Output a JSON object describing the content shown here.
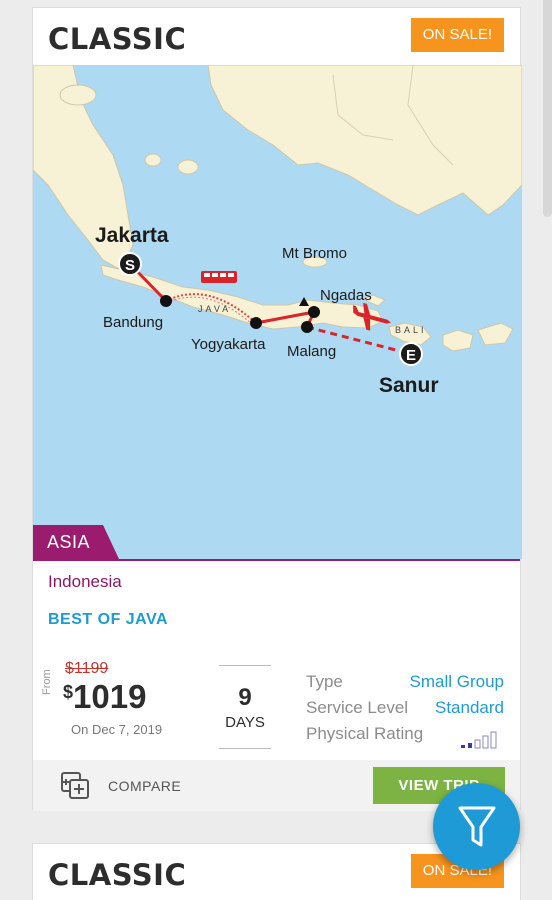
{
  "cards": [
    {
      "style": "CLASSIC",
      "badge": "ON SALE!",
      "region": "ASIA",
      "country": "Indonesia",
      "trip_name": "BEST OF JAVA",
      "price_prefix": "From",
      "old_price": "$1199",
      "currency_symbol": "$",
      "price": "1019",
      "departure": "On Dec 7, 2019",
      "days": "9",
      "days_label": "DAYS",
      "attributes": [
        {
          "label": "Type",
          "value": "Small Group"
        },
        {
          "label": "Service Level",
          "value": "Standard"
        },
        {
          "label": "Physical Rating",
          "value": ""
        }
      ],
      "physical_rating_icon": "rating-bars-icon",
      "compare_label": "COMPARE",
      "view_button": "VIEW TRIP",
      "map": {
        "start_city": "Jakarta",
        "end_city": "Sanur",
        "start_marker": "S",
        "end_marker": "E",
        "stops": [
          "Bandung",
          "Yogyakarta",
          "Mt Bromo",
          "Ngadas",
          "Malang"
        ],
        "island_labels": [
          "JAVA",
          "BALI"
        ]
      }
    },
    {
      "style": "CLASSIC",
      "badge": "ON SALE!"
    }
  ],
  "colors": {
    "accent": "#1f9bd1",
    "sale": "#f7941d",
    "region": "#9b1b6e",
    "view_button": "#7cb342",
    "old_price": "#c0392b"
  },
  "icons": {
    "compare": "compare-icon",
    "filter": "filter-icon"
  }
}
